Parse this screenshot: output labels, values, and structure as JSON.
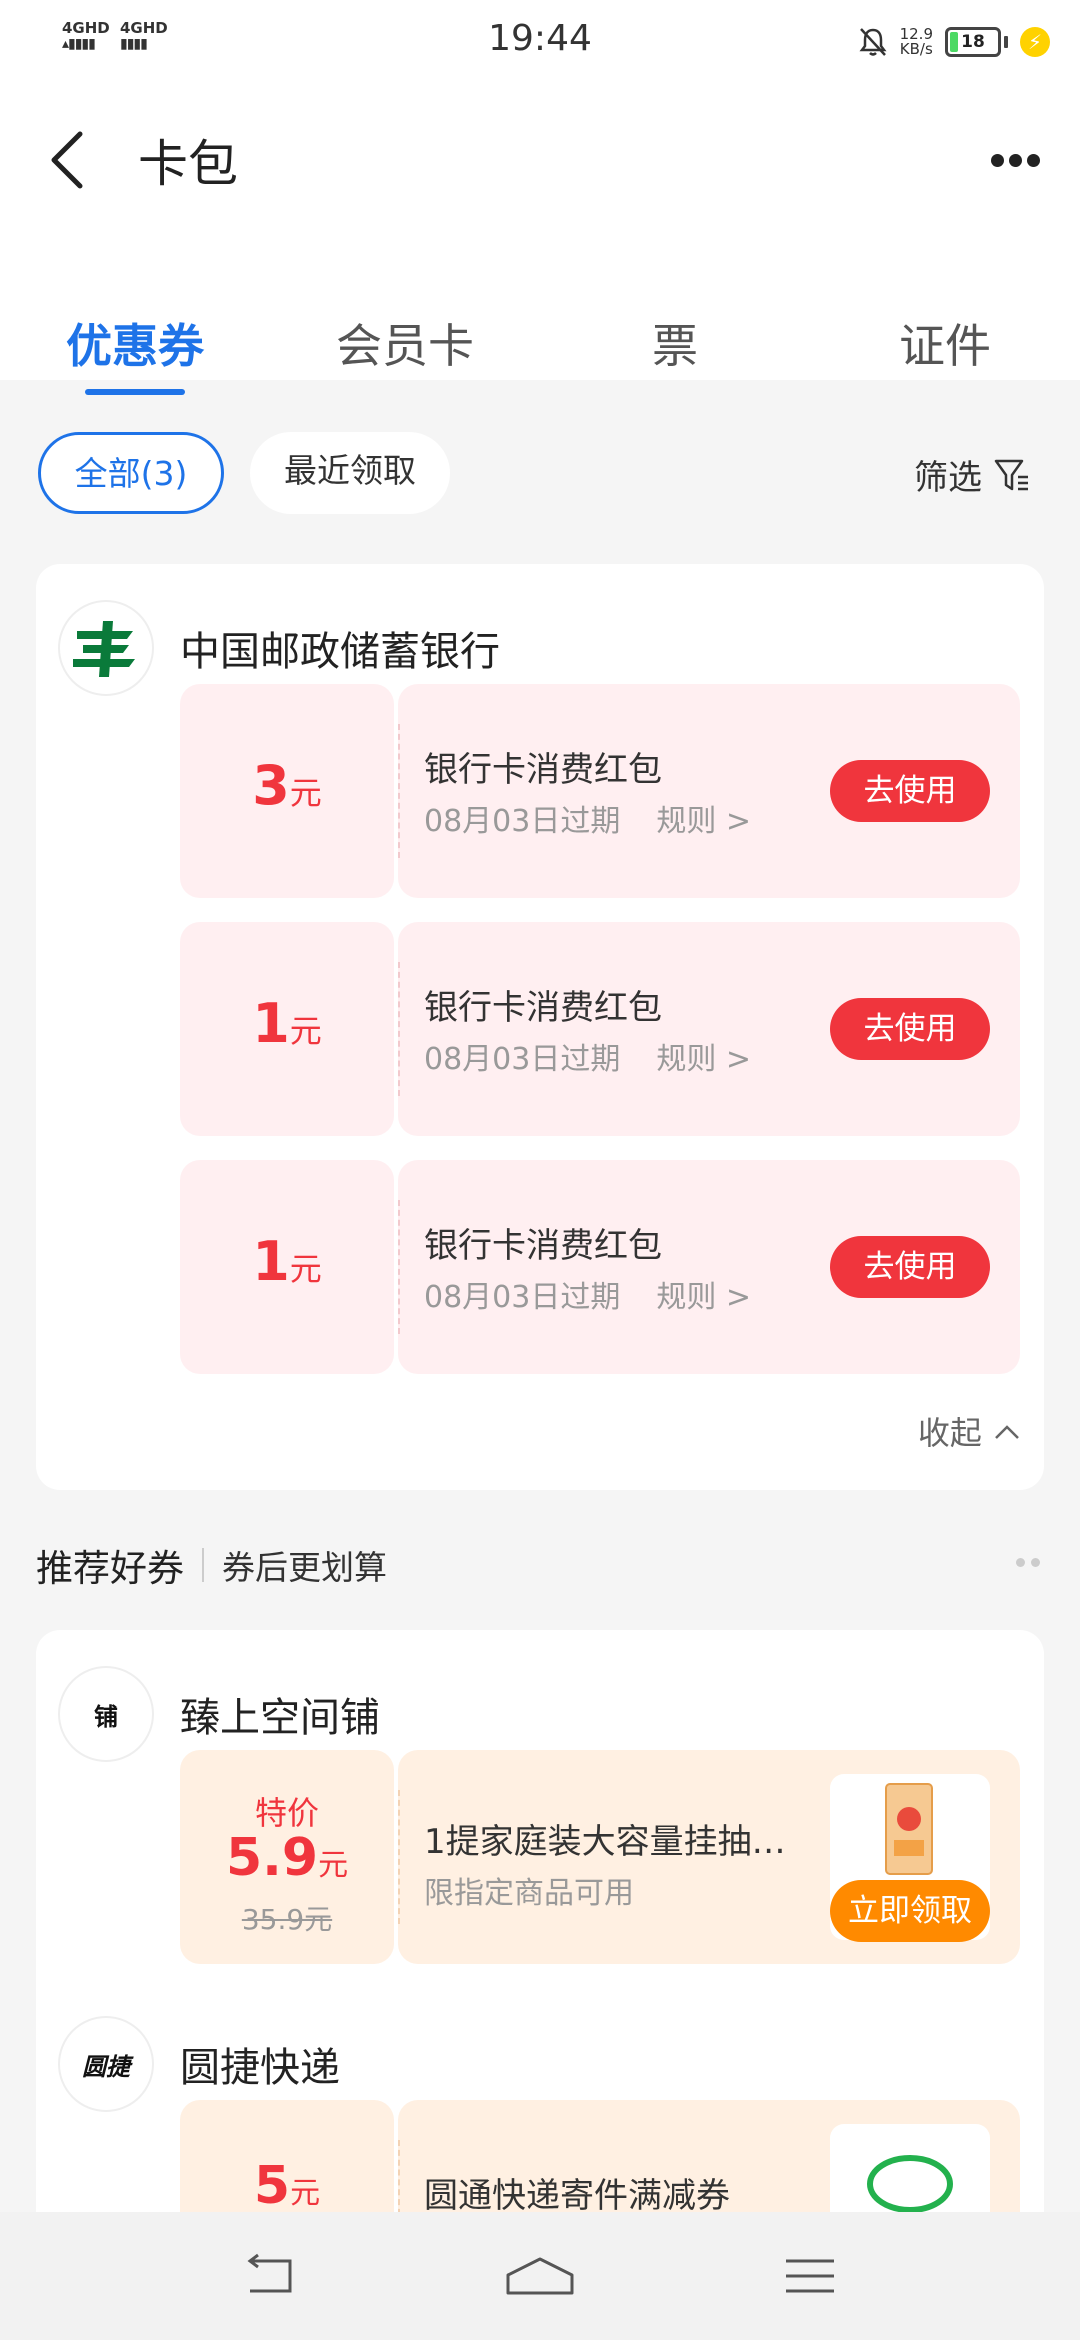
{
  "status_bar": {
    "sim1": "4GHD",
    "sim2": "4GHD",
    "time": "19:44",
    "speed_value": "12.9",
    "speed_unit": "KB/s",
    "battery": "18",
    "battery_level": 0.18
  },
  "header": {
    "title": "卡包"
  },
  "tabs": [
    {
      "label": "优惠券",
      "active": true
    },
    {
      "label": "会员卡",
      "active": false
    },
    {
      "label": "票",
      "active": false
    },
    {
      "label": "证件",
      "active": false
    }
  ],
  "filters": {
    "all": "全部(3)",
    "recent": "最近领取",
    "filter": "筛选"
  },
  "bank_card": {
    "merchant": "中国邮政储蓄银行",
    "coupons": [
      {
        "amount": "3",
        "unit": "元",
        "title": "银行卡消费红包",
        "expiry": "08月03日过期",
        "rules": "规则 >",
        "button": "去使用"
      },
      {
        "amount": "1",
        "unit": "元",
        "title": "银行卡消费红包",
        "expiry": "08月03日过期",
        "rules": "规则 >",
        "button": "去使用"
      },
      {
        "amount": "1",
        "unit": "元",
        "title": "银行卡消费红包",
        "expiry": "08月03日过期",
        "rules": "规则 >",
        "button": "去使用"
      }
    ],
    "collapse": "收起"
  },
  "recommend": {
    "title": "推荐好券",
    "subtitle": "券后更划算",
    "items": [
      {
        "merchant": "臻上空间铺",
        "logo_text": "铺",
        "tag": "特价",
        "price": "5.9",
        "unit": "元",
        "original": "35.9元",
        "title": "1提家庭装大容量挂抽…",
        "sub": "限指定商品可用",
        "button": "立即领取"
      },
      {
        "merchant": "圆捷快递",
        "logo_text": "圆捷",
        "price": "5",
        "unit": "元",
        "title": "圆通快递寄件满减券"
      }
    ]
  },
  "colors": {
    "accent": "#1e73e8",
    "coupon_red": "#f0353d",
    "claim_orange": "#ff8a00",
    "coupon_bg": "#ffeff1",
    "deal_bg": "#fff0e2"
  }
}
